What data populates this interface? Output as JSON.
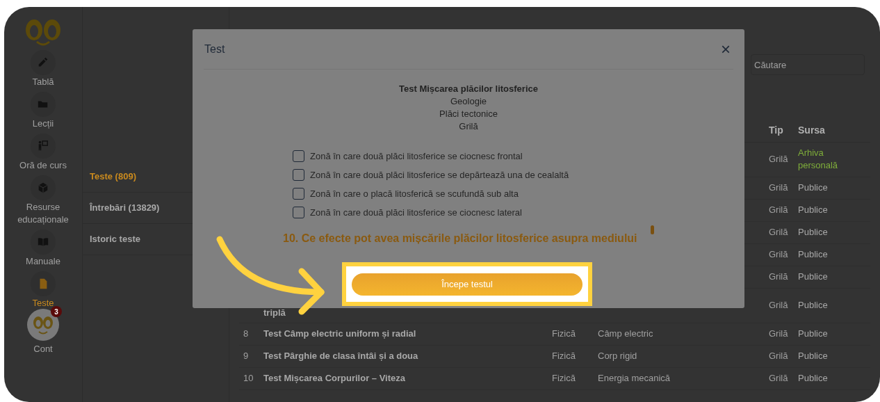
{
  "sidebar": {
    "items": [
      {
        "label": "Tablă",
        "selected": false
      },
      {
        "label": "Lecții",
        "selected": false
      },
      {
        "label": "Oră de curs",
        "selected": false
      },
      {
        "label": "Resurse educaționale",
        "selected": false
      },
      {
        "label": "Manuale",
        "selected": false
      },
      {
        "label": "Teste",
        "selected": true
      }
    ],
    "account": {
      "label": "Cont",
      "badge": "3"
    }
  },
  "subnav": {
    "items": [
      {
        "label": "Teste (809)",
        "selected": true
      },
      {
        "label": "Întrebări (13829)",
        "selected": false
      },
      {
        "label": "Istoric teste",
        "selected": false
      }
    ]
  },
  "search": {
    "placeholder": "Căutare"
  },
  "table": {
    "columns": [
      "Tip",
      "Sursa"
    ],
    "rows": [
      {
        "number": "",
        "name": "",
        "subject": "",
        "chapter": "",
        "type": "Grilă",
        "source": "Arhiva personală",
        "color": "#7fae3a"
      },
      {
        "number": "",
        "name": "",
        "subject": "",
        "chapter": "",
        "type": "Grilă",
        "source": "Publice",
        "color": "#a8a8a8"
      },
      {
        "number": "",
        "name": "",
        "subject": "",
        "chapter": "",
        "type": "Grilă",
        "source": "Publice",
        "color": "#a8a8a8"
      },
      {
        "number": "",
        "name": "",
        "subject": "",
        "chapter": "",
        "type": "Grilă",
        "source": "Publice",
        "color": "#a8a8a8"
      },
      {
        "number": "",
        "name": "",
        "subject": "",
        "chapter": "",
        "type": "Grilă",
        "source": "Publice",
        "color": "#a8a8a8"
      },
      {
        "number": "",
        "name": "",
        "subject": "",
        "chapter": "",
        "type": "Grilă",
        "source": "Publice",
        "color": "#a8a8a8"
      },
      {
        "number": "",
        "name": "triplă",
        "subject": "",
        "chapter": "",
        "type": "Grilă",
        "source": "Publice",
        "color": "#a8a8a8"
      },
      {
        "number": "8",
        "name": "Test Câmp electric uniform și radial",
        "subject": "Fizică",
        "chapter": "Câmp electric",
        "type": "Grilă",
        "source": "Publice",
        "color": "#a8a8a8"
      },
      {
        "number": "9",
        "name": "Test Pârghie de clasa întâi și a doua",
        "subject": "Fizică",
        "chapter": "Corp rigid",
        "type": "Grilă",
        "source": "Publice",
        "color": "#a8a8a8"
      },
      {
        "number": "10",
        "name": "Test Mișcarea Corpurilor – Viteza",
        "subject": "Fizică",
        "chapter": "Energia mecanică",
        "type": "Grilă",
        "source": "Publice",
        "color": "#a8a8a8"
      }
    ]
  },
  "modal": {
    "title": "Test",
    "close": "×",
    "test_title": "Test Mișcarea plăcilor litosferice",
    "details": [
      "Geologie",
      "Plăci tectonice",
      "Grilă"
    ],
    "options": [
      {
        "label": "Zonă în care două plăci litosferice se ciocnesc frontal",
        "checked": false
      },
      {
        "label": "Zonă în care două plăci litosferice se depărtează una de cealaltă",
        "checked": false
      },
      {
        "label": "Zonă în care o placă litosferică se scufundă sub alta",
        "checked": false
      },
      {
        "label": "Zonă în care două plăci litosferice se ciocnesc lateral",
        "checked": false
      }
    ],
    "next_question": "10. Ce efecte pot avea mișcările plăcilor litosferice asupra mediului",
    "start_button": "Începe testul"
  }
}
